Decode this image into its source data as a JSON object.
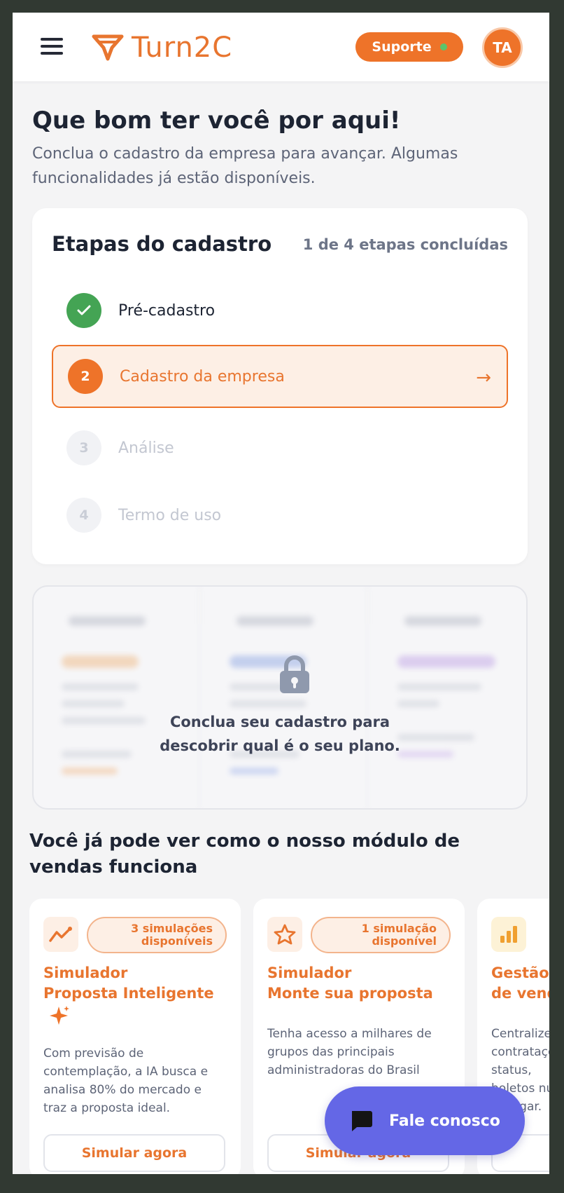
{
  "header": {
    "logo_text": "Turn2C",
    "support_label": "Suporte",
    "avatar_initials": "TA"
  },
  "greeting": {
    "title": "Que bom ter você por aqui!",
    "subtitle": "Conclua o cadastro da empresa para avançar. Algumas funcionalidades já estão disponíveis."
  },
  "steps": {
    "title": "Etapas do cadastro",
    "progress": "1 de 4 etapas concluídas",
    "items": [
      {
        "number": "1",
        "label": "Pré-cadastro",
        "status": "done"
      },
      {
        "number": "2",
        "label": "Cadastro da empresa",
        "status": "active"
      },
      {
        "number": "3",
        "label": "Análise",
        "status": "pending"
      },
      {
        "number": "4",
        "label": "Termo de uso",
        "status": "pending"
      }
    ]
  },
  "plans": {
    "locked_message_line1": "Conclua seu cadastro para",
    "locked_message_line2": "descobrir qual é o seu plano."
  },
  "modules": {
    "title": "Você já pode ver como o nosso módulo de vendas funciona",
    "cards": [
      {
        "icon": "chart-line-icon",
        "badge_line1": "3 simulações",
        "badge_line2": "disponíveis",
        "name_line1": "Simulador",
        "name_line2": "Proposta Inteligente",
        "description": "Com previsão de contemplação, a IA busca e analisa 80% do mercado e traz a proposta ideal.",
        "button": "Simular agora"
      },
      {
        "icon": "star-icon",
        "badge_line1": "1 simulação",
        "badge_line2": "disponível",
        "name_line1": "Simulador",
        "name_line2": "Monte sua proposta",
        "description": "Tenha acesso a milhares de grupos das principais administradoras do Brasil",
        "button": "Simular agora"
      },
      {
        "icon": "bar-chart-icon",
        "name_line1": "Gestão",
        "name_line2": "de vendas",
        "description": "Centralize contratações, status, boletos num só lugar."
      }
    ]
  },
  "chat": {
    "label": "Fale conosco"
  },
  "colors": {
    "brand_orange": "#ee7329",
    "success_green": "#44a454",
    "chat_purple": "#6467e6",
    "text_dark": "#1d2433"
  }
}
